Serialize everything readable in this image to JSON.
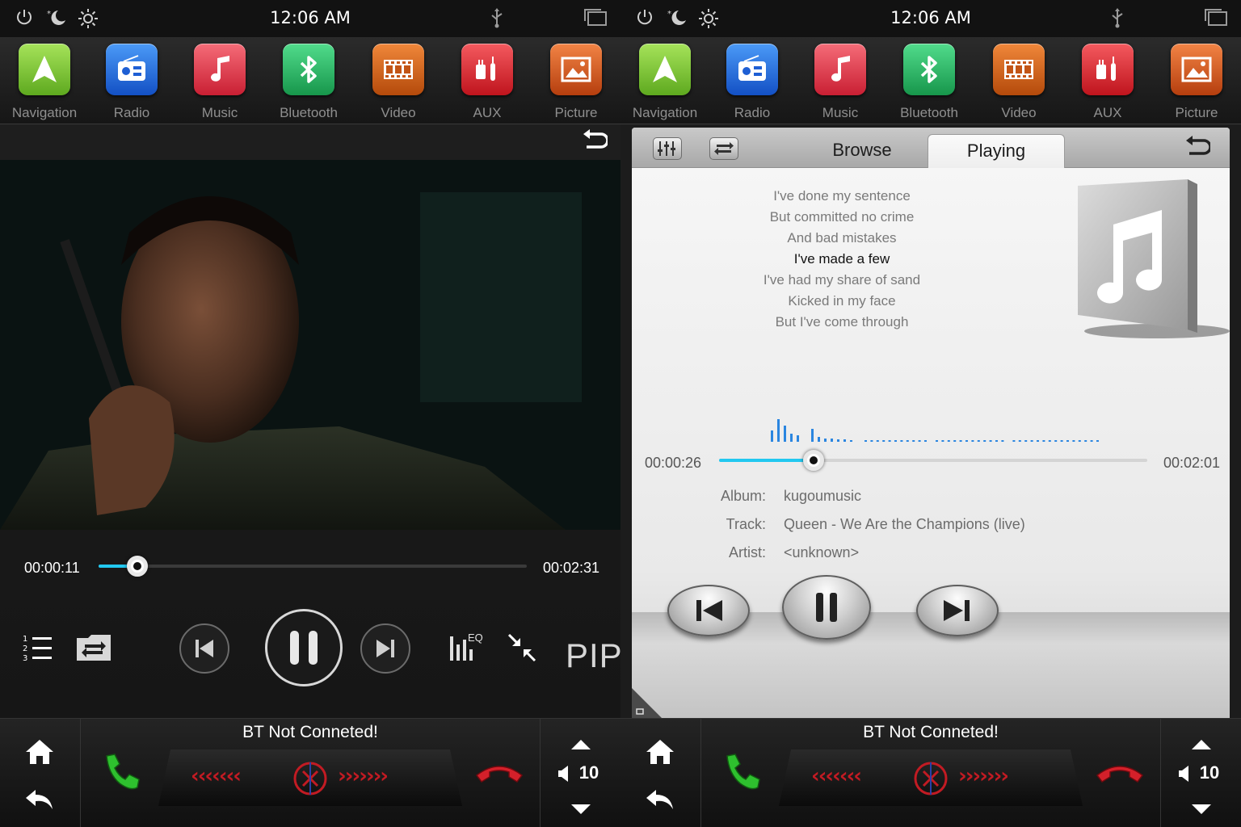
{
  "status": {
    "time": "12:06 AM",
    "icons": [
      "power-icon",
      "night-mode-icon",
      "brightness-icon",
      "usb-icon",
      "window-icon"
    ]
  },
  "apps": [
    {
      "label": "Navigation",
      "icon": "navigation-arrow-icon",
      "color": "#7cc433"
    },
    {
      "label": "Radio",
      "icon": "radio-icon",
      "color": "#1f6fe0"
    },
    {
      "label": "Music",
      "icon": "music-note-icon",
      "color": "#e23d4d"
    },
    {
      "label": "Bluetooth",
      "icon": "bluetooth-icon",
      "color": "#27b764"
    },
    {
      "label": "Video",
      "icon": "film-icon",
      "color": "#d46117"
    },
    {
      "label": "AUX",
      "icon": "aux-plug-icon",
      "color": "#d9262e"
    },
    {
      "label": "Picture",
      "icon": "picture-icon",
      "color": "#d8591f"
    }
  ],
  "video": {
    "elapsed": "00:00:11",
    "total": "00:02:31",
    "progress": 0.09,
    "eq_label": "EQ",
    "pip_label": "PIP"
  },
  "music": {
    "tabs": {
      "browse": "Browse",
      "playing": "Playing"
    },
    "lyrics": [
      "I've done my sentence",
      "But committed no crime",
      "And bad mistakes",
      "I've made a few",
      "I've had my share of sand",
      "Kicked in my face",
      "But I've come through"
    ],
    "active_lyric_index": 3,
    "elapsed": "00:00:26",
    "total": "00:02:01",
    "progress": 0.22,
    "info": {
      "album_label": "Album:",
      "album": "kugoumusic",
      "track_label": "Track:",
      "track": "Queen - We Are the Champions (live)",
      "artist_label": "Artist:",
      "artist": "<unknown>"
    }
  },
  "bottom": {
    "bt_status": "BT Not Conneted!",
    "volume": "10",
    "chevrons_left": "‹‹‹‹‹‹‹",
    "chevrons_right": "›››››››"
  },
  "colors": {
    "accent": "#22c8f0",
    "call_green": "#2ec02e",
    "hangup_red": "#d4202a"
  }
}
